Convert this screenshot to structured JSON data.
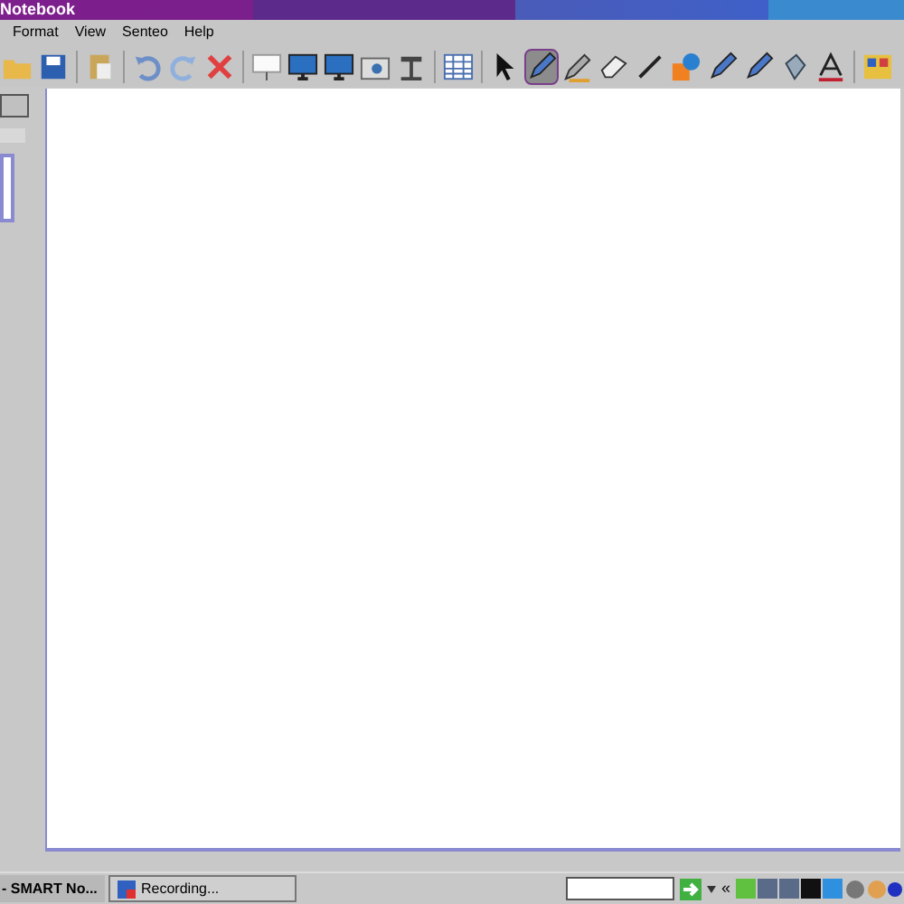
{
  "window": {
    "title": "Notebook"
  },
  "menu": [
    "Format",
    "View",
    "Senteo",
    "Help"
  ],
  "toolbar": [
    {
      "kind": "open",
      "selected": false
    },
    {
      "kind": "save",
      "selected": false
    },
    {
      "kind": "sep"
    },
    {
      "kind": "paste",
      "selected": false
    },
    {
      "kind": "sep"
    },
    {
      "kind": "undo",
      "selected": false
    },
    {
      "kind": "redo",
      "selected": false
    },
    {
      "kind": "delete",
      "selected": false
    },
    {
      "kind": "sep"
    },
    {
      "kind": "screen",
      "selected": false
    },
    {
      "kind": "monitor",
      "selected": false
    },
    {
      "kind": "monitor",
      "selected": false
    },
    {
      "kind": "camera",
      "selected": false
    },
    {
      "kind": "doccam",
      "selected": false
    },
    {
      "kind": "sep"
    },
    {
      "kind": "table",
      "selected": false
    },
    {
      "kind": "sep"
    },
    {
      "kind": "select",
      "selected": false
    },
    {
      "kind": "pen",
      "selected": true
    },
    {
      "kind": "pencil",
      "selected": false
    },
    {
      "kind": "eraser",
      "selected": false
    },
    {
      "kind": "line",
      "selected": false
    },
    {
      "kind": "shapes",
      "selected": false
    },
    {
      "kind": "pen",
      "selected": false
    },
    {
      "kind": "pen",
      "selected": false
    },
    {
      "kind": "bucket",
      "selected": false
    },
    {
      "kind": "text",
      "selected": false
    },
    {
      "kind": "sep"
    },
    {
      "kind": "props",
      "selected": false
    }
  ],
  "taskbar": {
    "tasks": [
      {
        "label": "- SMART No...",
        "selected": true
      },
      {
        "label": "Recording...",
        "selected": false
      }
    ],
    "tray_expand": "«"
  }
}
